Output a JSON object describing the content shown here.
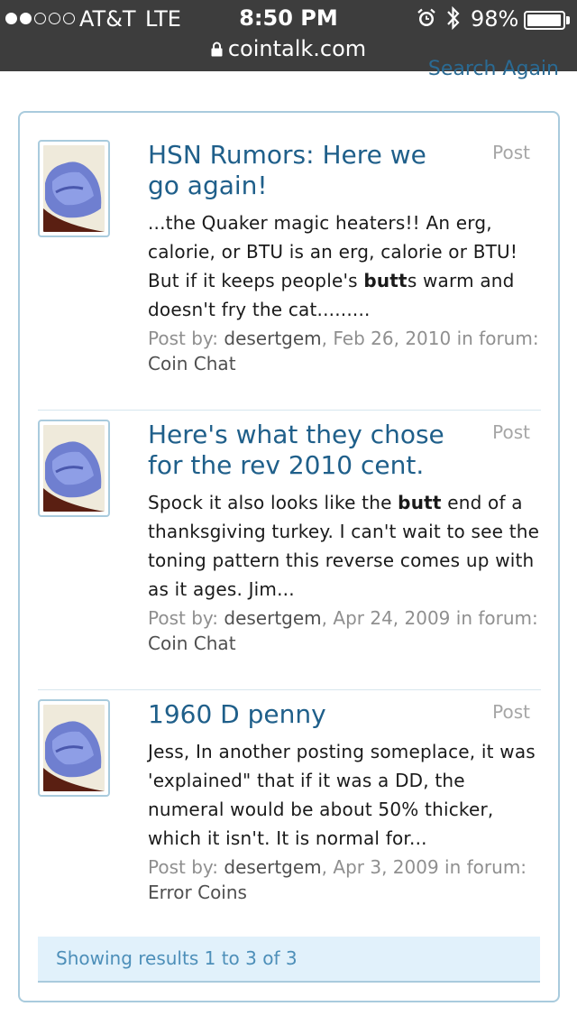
{
  "status_bar": {
    "carrier": "AT&T",
    "network": "LTE",
    "time": "8:50 PM",
    "battery": "98%",
    "battery_level": 0.98,
    "url": "cointalk.com"
  },
  "header": {
    "search_again_label": "Search Again"
  },
  "results": [
    {
      "title": "HSN Rumors: Here we go again!",
      "type": "Post",
      "snippet_before": "...the Quaker magic heaters!! An erg, calorie, or BTU is an erg, calorie or BTU! But if it keeps people's ",
      "snippet_bold": "butt",
      "snippet_after": "s warm and doesn't fry the cat.........",
      "post_by_label": "Post by:",
      "author": "desertgem",
      "date": "Feb 26, 2010",
      "in_forum_label": "in forum:",
      "forum": "Coin Chat"
    },
    {
      "title": "Here's what they chose for the rev 2010 cent.",
      "type": "Post",
      "snippet_before": "Spock it also looks like the ",
      "snippet_bold": "butt",
      "snippet_after": " end of a thanksgiving turkey. I can't wait to see the toning pattern this reverse comes up with as it ages. Jim...",
      "post_by_label": "Post by:",
      "author": "desertgem",
      "date": "Apr 24, 2009",
      "in_forum_label": "in forum:",
      "forum": "Coin Chat"
    },
    {
      "title": "1960 D penny",
      "type": "Post",
      "snippet_before": "Jess, In another posting someplace, it was 'explained\" that if it was a DD, the numeral would be about 50% thicker, which it isn't. It is normal for...",
      "snippet_bold": "",
      "snippet_after": "",
      "post_by_label": "Post by:",
      "author": "desertgem",
      "date": "Apr 3, 2009",
      "in_forum_label": "in forum:",
      "forum": "Error Coins"
    }
  ],
  "pager": {
    "label": "Showing results 1 to 3 of 3"
  },
  "colors": {
    "status_bar_bg": "#3d3d3d",
    "link": "#1f5f8a",
    "border": "#a9cbdd",
    "pager_bg": "#e1f1fb",
    "pager_text": "#4d8fb9",
    "meta_muted": "#8f8f8f"
  },
  "icons": [
    "signal-dots-icon",
    "lock-icon",
    "alarm-clock-icon",
    "bluetooth-icon",
    "battery-icon"
  ]
}
